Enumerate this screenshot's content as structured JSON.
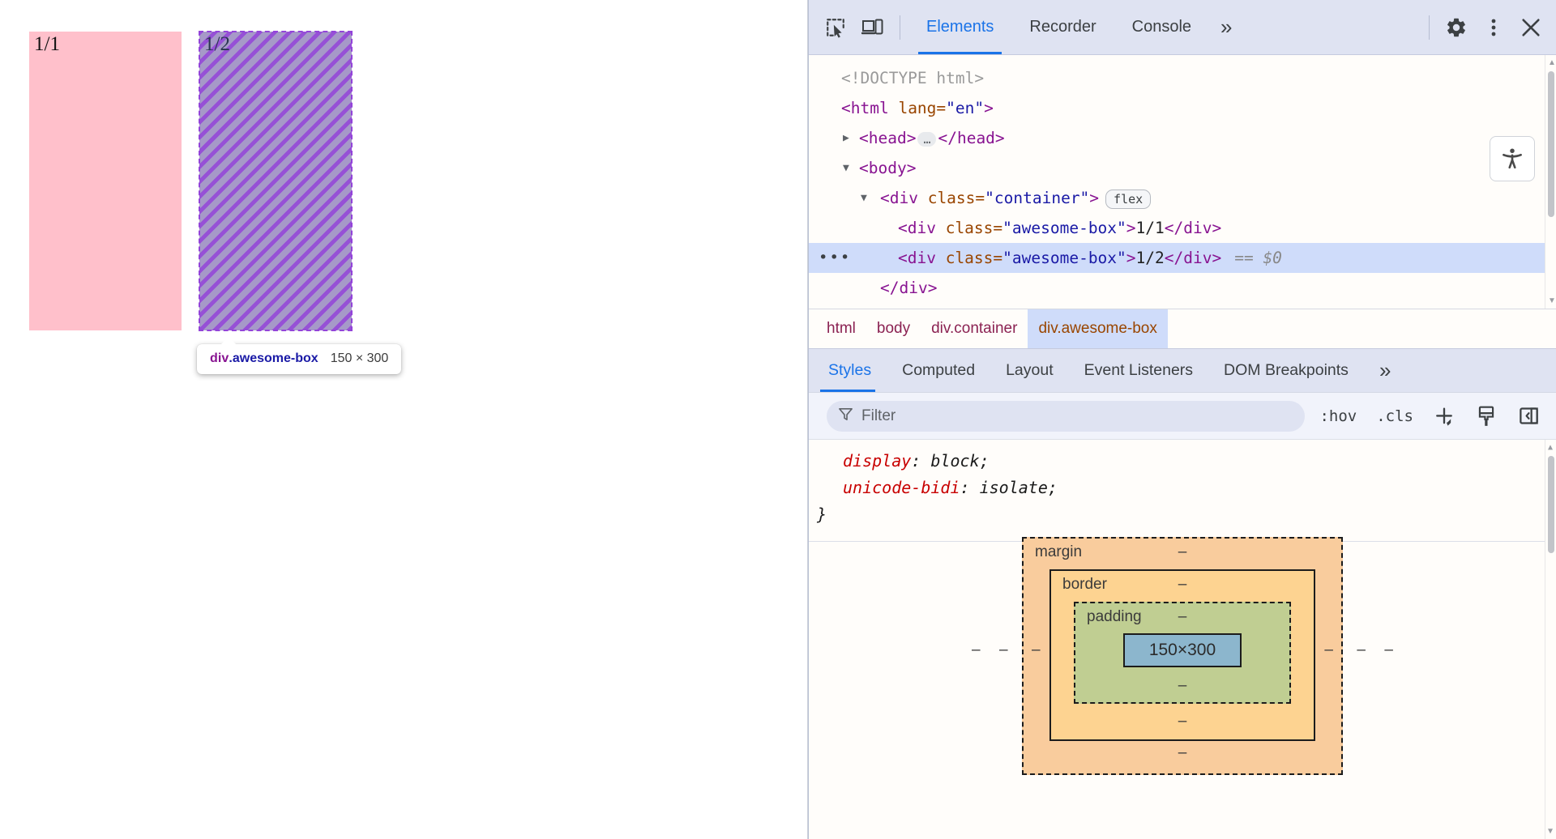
{
  "page": {
    "boxes": [
      {
        "label": "1/1",
        "class": "awesome-box"
      },
      {
        "label": "1/2",
        "class": "awesome-box"
      }
    ],
    "tooltip": {
      "tag": "div",
      "class": ".awesome-box",
      "dimensions": "150 × 300"
    }
  },
  "devtools": {
    "toolbar": {
      "inspect_icon": "inspect-cursor-icon",
      "device_icon": "device-toolbar-icon",
      "tabs": [
        {
          "label": "Elements",
          "active": true
        },
        {
          "label": "Recorder",
          "active": false
        },
        {
          "label": "Console",
          "active": false
        }
      ],
      "more_tabs": "»",
      "settings_icon": "gear-icon",
      "menu_icon": "kebab-menu-icon",
      "close_icon": "close-icon"
    },
    "dom": {
      "accessibility_button": "accessibility-icon",
      "lines": {
        "doctype": "<!DOCTYPE html>",
        "html_open_tag": "<html",
        "html_attr": "lang",
        "html_value": "\"en\"",
        "html_close_bracket": ">",
        "head": "<head>",
        "head_close": "</head>",
        "head_ellipsis": "…",
        "body": "<body>",
        "container_open": "<div ",
        "container_attr": "class=",
        "container_value": "\"container\"",
        "container_close_bracket": ">",
        "flex_badge": "flex",
        "child1_open": "<div ",
        "child1_attr": "class=",
        "child1_value": "\"awesome-box\"",
        "child1_gt": ">",
        "child1_text": "1/1",
        "child1_close": "</div>",
        "child2_open": "<div ",
        "child2_attr": "class=",
        "child2_value": "\"awesome-box\"",
        "child2_gt": ">",
        "child2_text": "1/2",
        "child2_close": "</div>",
        "child2_selected_marker": "== $0",
        "row_dots": "•••",
        "container_close": "</div>"
      }
    },
    "breadcrumb": [
      {
        "label": "html",
        "selected": false
      },
      {
        "label": "body",
        "selected": false
      },
      {
        "label": "div.container",
        "selected": false
      },
      {
        "label": "div.awesome-box",
        "selected": true
      }
    ],
    "style_tabs": [
      {
        "label": "Styles",
        "active": true
      },
      {
        "label": "Computed",
        "active": false
      },
      {
        "label": "Layout",
        "active": false
      },
      {
        "label": "Event Listeners",
        "active": false
      },
      {
        "label": "DOM Breakpoints",
        "active": false
      }
    ],
    "style_tabs_more": "»",
    "filter_bar": {
      "filter_icon": "filter-funnel-icon",
      "placeholder": "Filter",
      "value": "",
      "hov_label": ":hov",
      "cls_label": ".cls",
      "new_rule_icon": "plus-new-style-rule-icon",
      "copy_icon": "paintbrush-icon",
      "sidebar_icon": "toggle-sidebar-icon"
    },
    "rules": [
      {
        "property": "display",
        "value": "block;"
      },
      {
        "property": "unicode-bidi",
        "value": "isolate;"
      }
    ],
    "rule_close_brace": "}",
    "box_model": {
      "margin_label": "margin",
      "margin_value": "–",
      "border_label": "border",
      "border_value": "–",
      "padding_label": "padding",
      "padding_value": "–",
      "content": "150×300",
      "side_dashes": "–"
    }
  },
  "colors": {
    "accent_blue": "#1a73e8",
    "box_pink": "#ffc0cb",
    "highlight_purple": "#9344d9",
    "selection_blue": "#cfdcfa",
    "margin_orange": "#f9cc9d",
    "border_orange": "#fdd391",
    "padding_green": "#c0ce92",
    "content_blue": "#8cb6cd"
  }
}
